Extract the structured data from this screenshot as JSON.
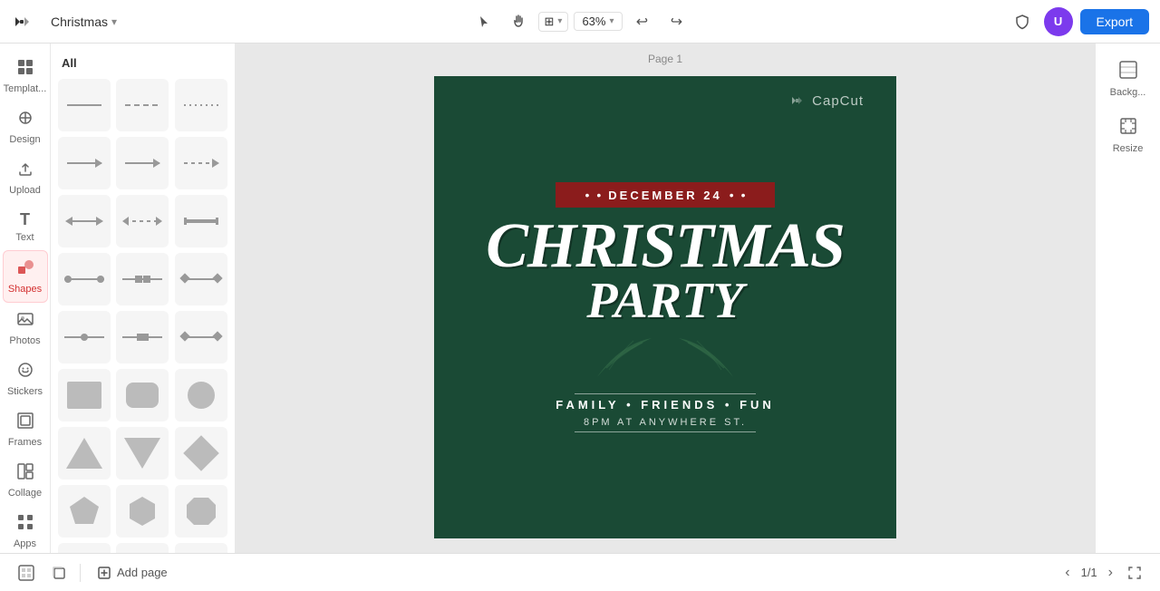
{
  "app": {
    "title": "CapCut",
    "logo_alt": "CapCut logo"
  },
  "topbar": {
    "project_name": "Christmas",
    "export_label": "Export",
    "zoom_level": "63%",
    "avatar_initials": "U"
  },
  "sidebar": {
    "items": [
      {
        "id": "templates",
        "label": "Templat...",
        "icon": "⊞"
      },
      {
        "id": "design",
        "label": "Design",
        "icon": "✦"
      },
      {
        "id": "upload",
        "label": "Upload",
        "icon": "⬆"
      },
      {
        "id": "text",
        "label": "Text",
        "icon": "T"
      },
      {
        "id": "shapes",
        "label": "Shapes",
        "icon": "◈",
        "active": true
      },
      {
        "id": "photos",
        "label": "Photos",
        "icon": "🖼"
      },
      {
        "id": "stickers",
        "label": "Stickers",
        "icon": "☺"
      },
      {
        "id": "frames",
        "label": "Frames",
        "icon": "▣"
      },
      {
        "id": "collage",
        "label": "Collage",
        "icon": "⊟"
      },
      {
        "id": "apps",
        "label": "Apps",
        "icon": "⋯"
      }
    ]
  },
  "shapes_panel": {
    "header": "All"
  },
  "canvas": {
    "page_label": "Page 1",
    "design": {
      "logo_text": "CapCut",
      "date_text": "DECEMBER 24",
      "title_line1": "CHRISTMAS",
      "title_line2": "PARTY",
      "tagline": "FAMILY • FRIENDS • FUN",
      "address": "8PM AT ANYWHERE ST."
    }
  },
  "right_panel": {
    "items": [
      {
        "id": "background",
        "label": "Backg...",
        "icon": "▨"
      },
      {
        "id": "resize",
        "label": "Resize",
        "icon": "⊡"
      }
    ]
  },
  "bottom_bar": {
    "add_page_label": "Add page",
    "page_counter": "1/1"
  }
}
